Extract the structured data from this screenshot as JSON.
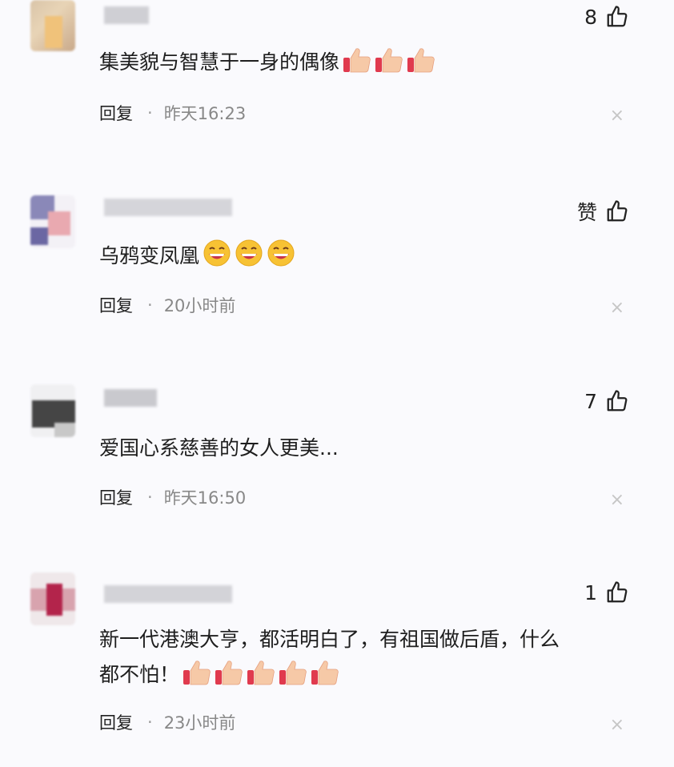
{
  "comments": [
    {
      "likes": "8",
      "text": "集美貌与智慧于一身的偶像",
      "emoji": "thumbs-up-icon",
      "emoji_count": 3,
      "reply": "回复",
      "dot": "·",
      "time": "昨天16:23",
      "close": "×"
    },
    {
      "likes": "赞",
      "text": "乌鸦变凤凰",
      "emoji": "grin-icon",
      "emoji_count": 3,
      "reply": "回复",
      "dot": "·",
      "time": "20小时前",
      "close": "×"
    },
    {
      "likes": "7",
      "text": "爱国心系慈善的女人更美...",
      "emoji_count": 0,
      "reply": "回复",
      "dot": "·",
      "time": "昨天16:50",
      "close": "×"
    },
    {
      "likes": "1",
      "text_line1": "新一代港澳大亨，都活明白了，有祖国做后盾，什么",
      "text_line2": "都不怕！",
      "emoji": "thumbs-up-icon",
      "emoji_count": 5,
      "reply": "回复",
      "dot": "·",
      "time": "23小时前",
      "close": "×"
    }
  ]
}
